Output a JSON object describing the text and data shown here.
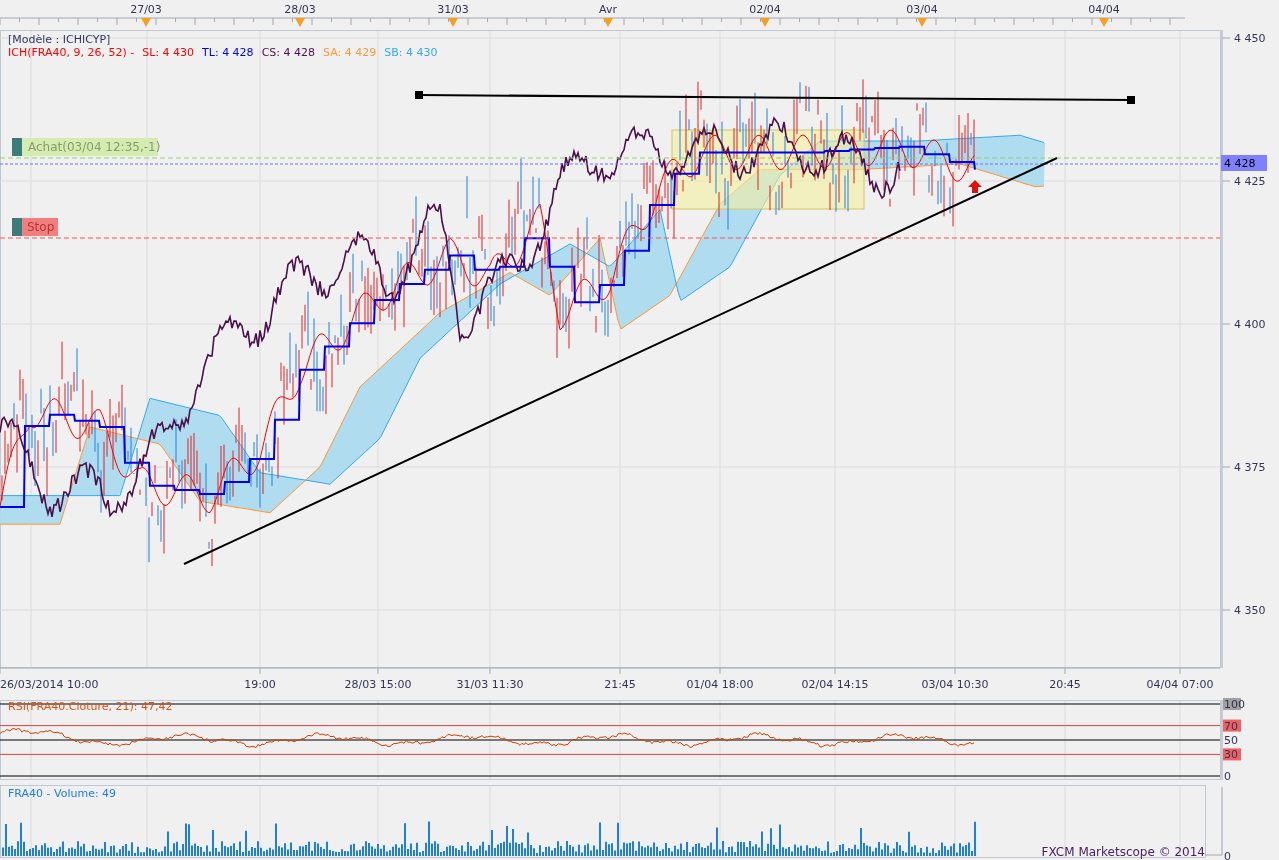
{
  "top_axis": {
    "labels": [
      "27/03",
      "28/03",
      "31/03",
      "Avr",
      "02/04",
      "03/04",
      "04/04"
    ]
  },
  "legend": {
    "model": "[Modèle : ICHICYP]",
    "indicator": {
      "text": "ICH(FRA40, 9, 26, 52) -",
      "color": "#ff0000"
    },
    "values": [
      {
        "text": "SL: 4 430",
        "color": "#ff0000"
      },
      {
        "text": "TL: 4 428",
        "color": "#0000ff"
      },
      {
        "text": "CS: 4 428",
        "color": "#4b0f4b"
      },
      {
        "text": "SA: 4 429",
        "color": "#ff9933"
      },
      {
        "text": "SB: 4 430",
        "color": "#33aaee"
      }
    ]
  },
  "orders": [
    {
      "kind": "entry",
      "label": "Achat(03/04 12:35,-1)"
    },
    {
      "kind": "stop",
      "label": "Stop"
    }
  ],
  "price_axis": {
    "labels": [
      "4 450",
      "4 425",
      "4 400",
      "4 375",
      "4 350"
    ],
    "current": "4 428"
  },
  "time_axis": {
    "labels": [
      "26/03/2014 10:00",
      "19:00",
      "28/03 15:00",
      "31/03 11:30",
      "21:45",
      "01/04 18:00",
      "02/04 14:15",
      "03/04 10:30",
      "20:45",
      "04/04 07:00"
    ]
  },
  "rsi": {
    "title": "RSI(FRA40.Cloture, 21): 47,42",
    "levels": [
      {
        "text": "100",
        "kind": "bound"
      },
      {
        "text": "70",
        "kind": "threshold"
      },
      {
        "text": "50",
        "kind": "mid"
      },
      {
        "text": "30",
        "kind": "threshold"
      },
      {
        "text": "0",
        "kind": "plain"
      }
    ]
  },
  "volume": {
    "title": "FRA40 - Volume: 49",
    "axis_label": "0"
  },
  "copyright": "FXCM Marketscope © 2014"
}
